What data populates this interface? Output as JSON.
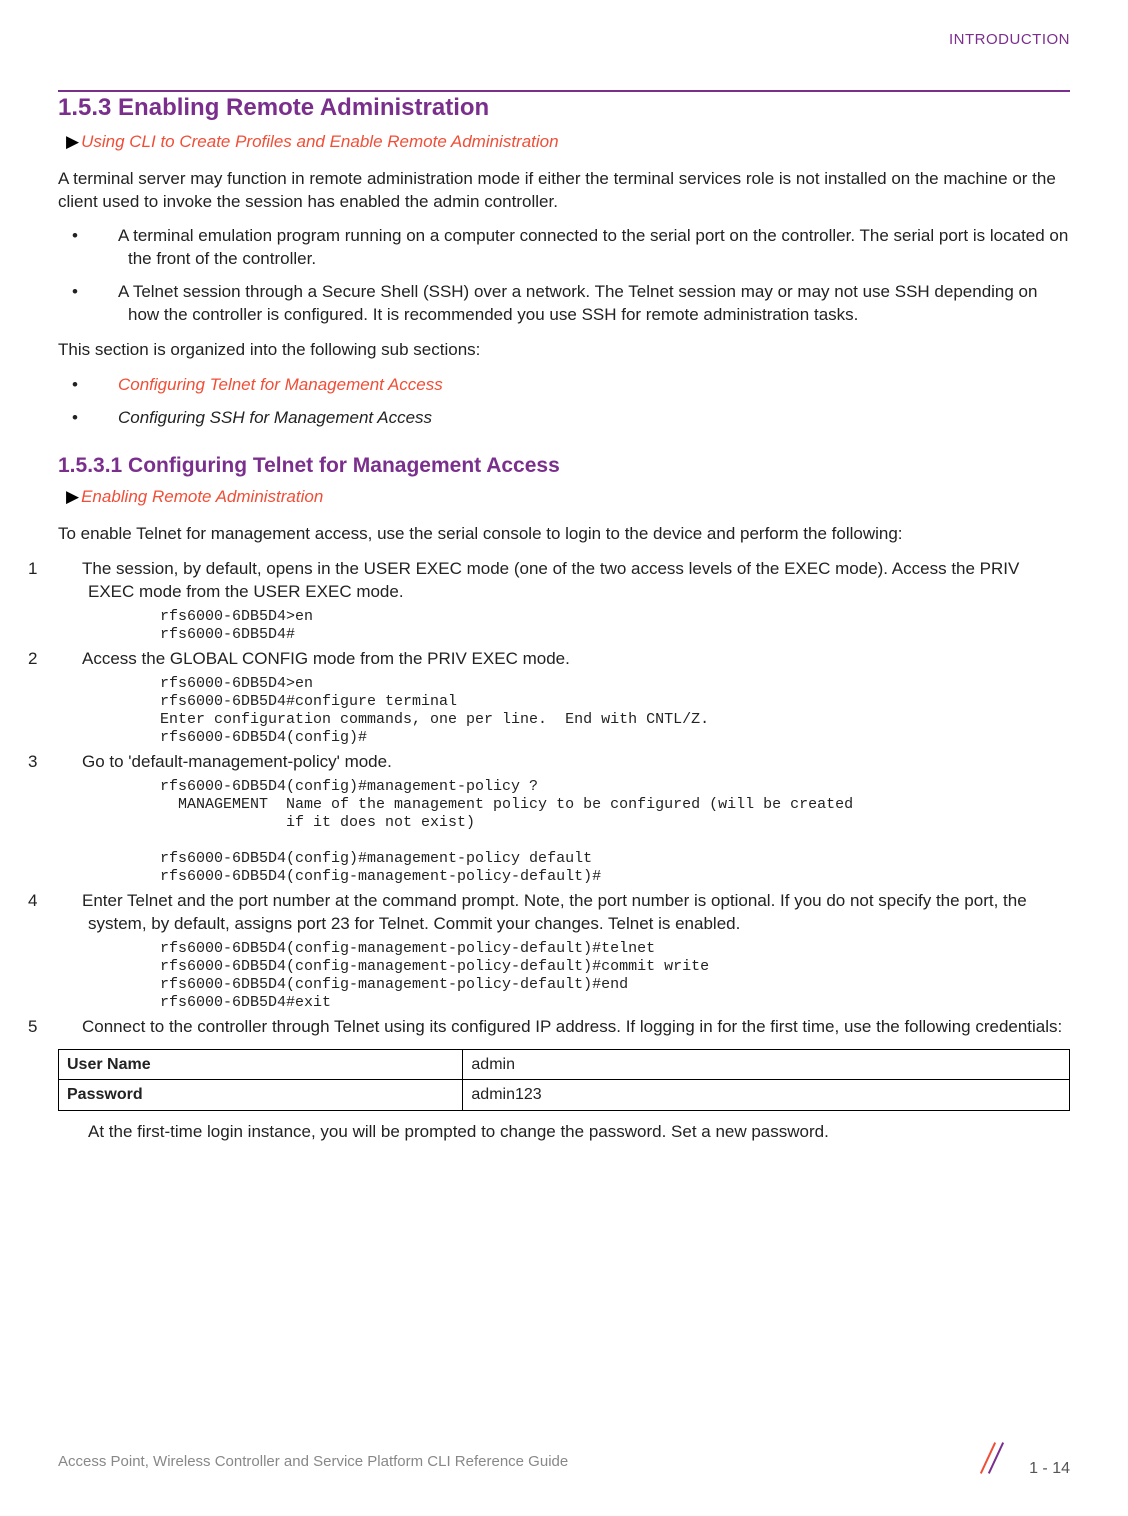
{
  "header": {
    "chapter": "INTRODUCTION"
  },
  "section": {
    "number_title": "1.5.3 Enabling Remote Administration",
    "breadcrumb": "Using CLI to Create Profiles and Enable Remote Administration",
    "intro": "A terminal server may function in remote administration mode if either the terminal services role is not installed on the machine or the client used to invoke the session has enabled the admin controller.",
    "bullets": [
      "A terminal emulation program running on a computer connected to the serial port on the controller. The serial port is located on the front of the controller.",
      "A Telnet session through a Secure Shell (SSH) over a network. The Telnet session may or may not use SSH depending on how the controller is configured. It is recommended you use SSH for remote administration tasks."
    ],
    "subsections_intro": "This section is organized into the following sub sections:",
    "subsections": [
      {
        "label": "Configuring Telnet for Management Access",
        "link": true
      },
      {
        "label": "Configuring SSH for Management Access",
        "link": false
      }
    ]
  },
  "subsection": {
    "title": "1.5.3.1 Configuring Telnet for Management Access",
    "breadcrumb": "Enabling Remote Administration",
    "intro": "To enable Telnet for management access, use the serial console to login to the device and perform the following:",
    "steps": [
      {
        "num": "1",
        "text": "The session, by default, opens in the USER EXEC mode (one of the two access levels of the EXEC mode). Access the PRIV EXEC mode from the USER EXEC mode.",
        "code": "rfs6000-6DB5D4>en\nrfs6000-6DB5D4#"
      },
      {
        "num": "2",
        "text": "Access the GLOBAL CONFIG mode from the PRIV EXEC mode.",
        "code": "rfs6000-6DB5D4>en\nrfs6000-6DB5D4#configure terminal\nEnter configuration commands, one per line.  End with CNTL/Z.\nrfs6000-6DB5D4(config)#"
      },
      {
        "num": "3",
        "text": "Go to 'default-management-policy' mode.",
        "code": "rfs6000-6DB5D4(config)#management-policy ?\n  MANAGEMENT  Name of the management policy to be configured (will be created\n              if it does not exist)\n\nrfs6000-6DB5D4(config)#management-policy default\nrfs6000-6DB5D4(config-management-policy-default)#"
      },
      {
        "num": "4",
        "text": "Enter Telnet and the port number at the command prompt. Note, the port number is optional. If you do not specify the port, the system, by default, assigns port 23 for Telnet. Commit your changes. Telnet is enabled.",
        "code": "rfs6000-6DB5D4(config-management-policy-default)#telnet\nrfs6000-6DB5D4(config-management-policy-default)#commit write\nrfs6000-6DB5D4(config-management-policy-default)#end\nrfs6000-6DB5D4#exit"
      },
      {
        "num": "5",
        "text": "Connect to the controller through Telnet using its configured IP address. If logging in for the first time, use the following credentials:"
      }
    ],
    "credentials": {
      "user_label": "User Name",
      "user_value": "admin",
      "pass_label": "Password",
      "pass_value": "admin123"
    },
    "post_table": "At the first-time login instance, you will be prompted to change the password. Set a new password."
  },
  "footer": {
    "guide_title": "Access Point, Wireless Controller and Service Platform CLI Reference Guide",
    "page_number": "1 - 14"
  }
}
